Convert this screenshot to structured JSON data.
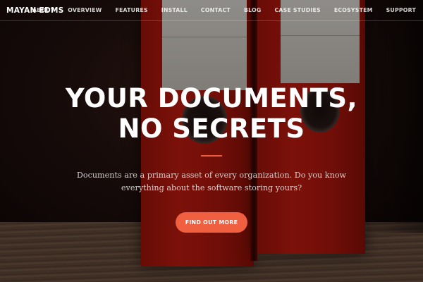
{
  "navbar": {
    "brand": "MAYAN EDMS",
    "links": [
      "ABOUT",
      "OVERVIEW",
      "FEATURES",
      "INSTALL",
      "CONTACT",
      "BLOG",
      "CASE STUDIES",
      "ECOSYSTEM",
      "SUPPORT"
    ]
  },
  "hero": {
    "headline_line1": "YOUR DOCUMENTS,",
    "headline_line2": "NO SECRETS",
    "subtitle": "Documents are a primary asset of every organization. Do you know everything about the software storing yours?",
    "cta_label": "FIND OUT MORE"
  },
  "colors": {
    "accent": "#f05f40",
    "text": "#ffffff"
  }
}
